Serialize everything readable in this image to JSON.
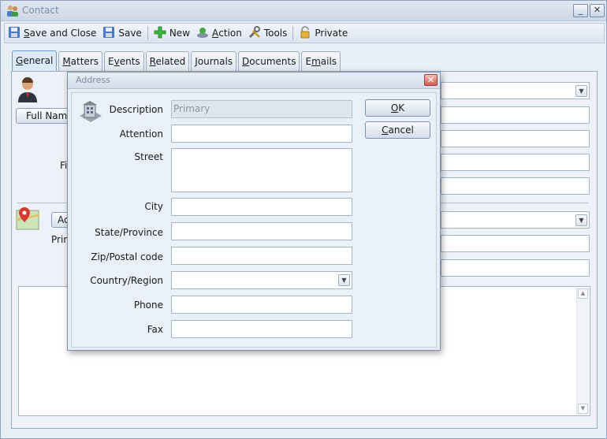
{
  "window": {
    "title": "Contact",
    "minimize_label": "_",
    "close_label": "✕"
  },
  "toolbar": {
    "save_close": {
      "pre": "",
      "mnemonic": "S",
      "post": "ave and Close"
    },
    "save": "Save",
    "new": "New",
    "action": {
      "pre": "",
      "mnemonic": "A",
      "post": "ction"
    },
    "tools": "Tools",
    "private": "Private"
  },
  "tabs": [
    {
      "pre": "",
      "mnemonic": "G",
      "post": "eneral",
      "active": true
    },
    {
      "pre": "",
      "mnemonic": "M",
      "post": "atters"
    },
    {
      "pre": "E",
      "mnemonic": "v",
      "post": "ents"
    },
    {
      "pre": "",
      "mnemonic": "R",
      "post": "elated"
    },
    {
      "pre": "",
      "mnemonic": "J",
      "post": "ournals"
    },
    {
      "pre": "",
      "mnemonic": "D",
      "post": "ocuments"
    },
    {
      "pre": "E",
      "mnemonic": "m",
      "post": "ails"
    }
  ],
  "background": {
    "full_name_button": "Full Nam",
    "fi_label": "Fi",
    "address_button": "Ac",
    "primary_label": "Prir"
  },
  "dialog": {
    "title": "Address",
    "close_label": "✕",
    "fields": {
      "description": {
        "label": "Description",
        "value": "Primary"
      },
      "attention": {
        "label": "Attention",
        "value": ""
      },
      "street": {
        "label": "Street",
        "value": ""
      },
      "city": {
        "label": "City",
        "value": ""
      },
      "state": {
        "label": "State/Province",
        "value": ""
      },
      "zip": {
        "label": "Zip/Postal code",
        "value": ""
      },
      "country": {
        "label": "Country/Region",
        "value": ""
      },
      "phone": {
        "label": "Phone",
        "value": ""
      },
      "fax": {
        "label": "Fax",
        "value": ""
      }
    },
    "ok": {
      "pre": "",
      "mnemonic": "O",
      "post": "K"
    },
    "cancel": {
      "pre": "",
      "mnemonic": "C",
      "post": "ancel"
    }
  },
  "colors": {
    "window_bg": "#e8eef6",
    "dialog_bg": "#e7edf5",
    "active_tab": "#dce9f7",
    "close_red": "#d25b4f"
  }
}
